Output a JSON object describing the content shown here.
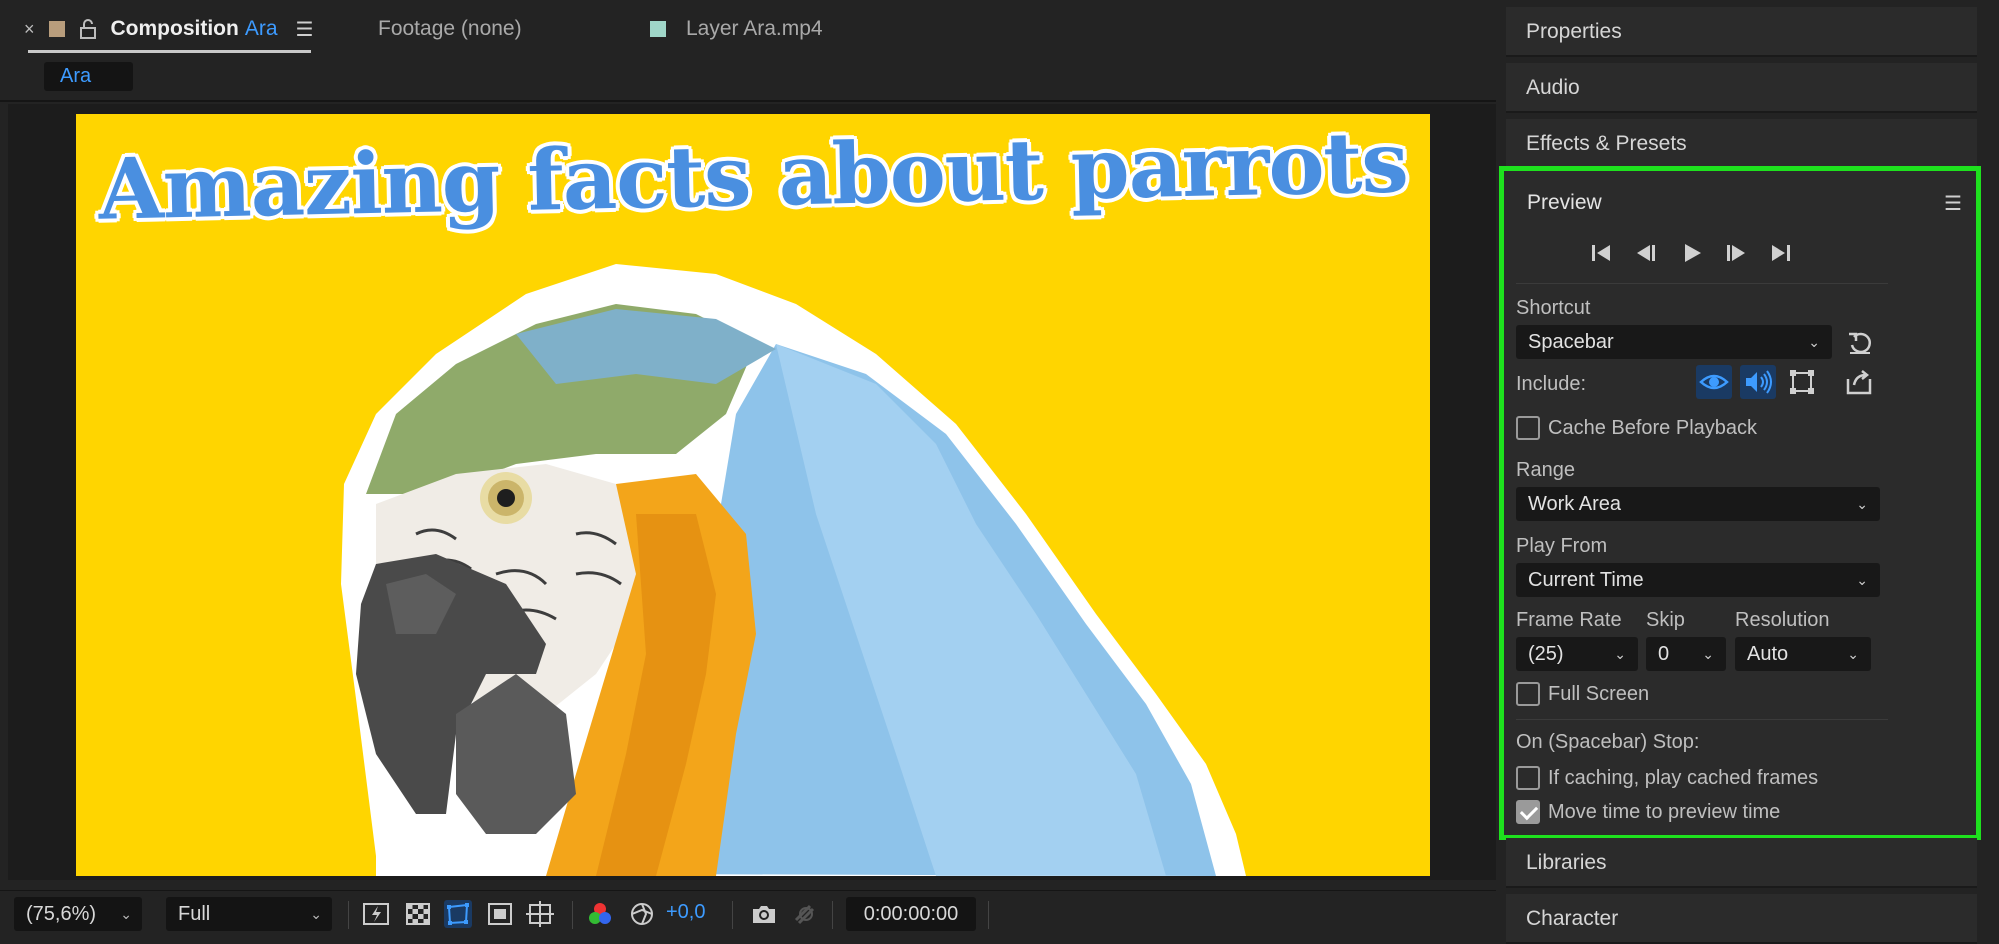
{
  "composition_panel": {
    "tabs": {
      "composition": {
        "title": "Composition",
        "name": "Ara"
      },
      "footage": {
        "label": "Footage (none)"
      },
      "layer": {
        "label": "Layer Ara.mp4"
      }
    },
    "breadcrumb": "Ara",
    "viewer": {
      "headline": "Amazing facts about parrots"
    },
    "toolbar": {
      "magnification": "(75,6%)",
      "resolution": "Full",
      "exposure": "+0,0",
      "timecode": "0:00:00:00"
    }
  },
  "right_panels": {
    "properties": "Properties",
    "audio": "Audio",
    "effects_presets": "Effects & Presets",
    "libraries": "Libraries",
    "character": "Character"
  },
  "preview": {
    "title": "Preview",
    "shortcut_label": "Shortcut",
    "shortcut_value": "Spacebar",
    "include_label": "Include:",
    "cache_before_playback": "Cache Before Playback",
    "range_label": "Range",
    "range_value": "Work Area",
    "play_from_label": "Play From",
    "play_from_value": "Current Time",
    "frame_rate_label": "Frame Rate",
    "frame_rate_value": "(25)",
    "skip_label": "Skip",
    "skip_value": "0",
    "resolution_label": "Resolution",
    "resolution_value": "Auto",
    "full_screen": "Full Screen",
    "on_stop_label": "On (Spacebar) Stop:",
    "if_caching": "If caching, play cached frames",
    "move_time": "Move time to preview time",
    "checkbox_states": {
      "cache_before_playback": false,
      "full_screen": false,
      "if_caching": false,
      "move_time": true
    }
  },
  "colors": {
    "accent": "#3d9bff",
    "highlight_border": "#1ee11e",
    "frame_background": "#ffd500"
  }
}
